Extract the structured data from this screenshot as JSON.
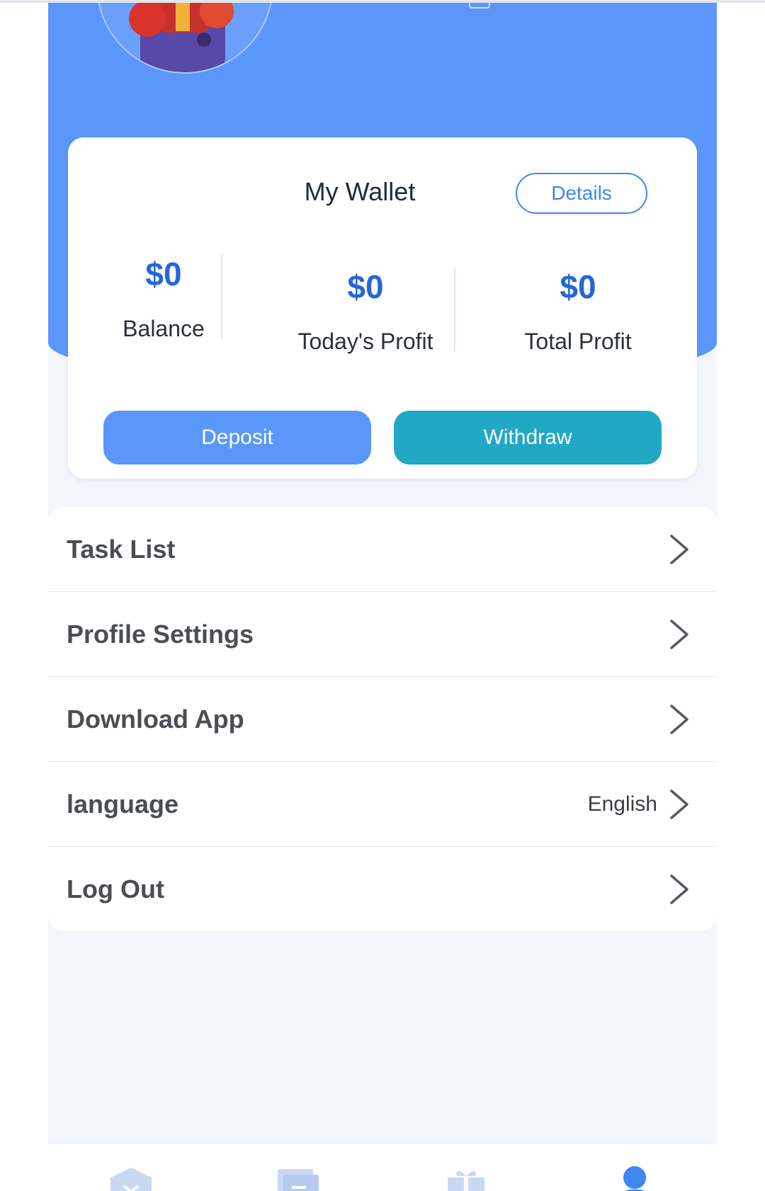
{
  "wallet": {
    "title": "My Wallet",
    "details_label": "Details",
    "balance_value": "$0",
    "balance_label": "Balance",
    "today_profit_value": "$0",
    "today_profit_label": "Today's Profit",
    "total_profit_value": "$0",
    "total_profit_label": "Total Profit",
    "deposit_label": "Deposit",
    "withdraw_label": "Withdraw"
  },
  "menu": {
    "items": [
      {
        "label": "Task List",
        "value": ""
      },
      {
        "label": "Profile Settings",
        "value": ""
      },
      {
        "label": "Download App",
        "value": ""
      },
      {
        "label": "language",
        "value": "English"
      },
      {
        "label": "Log Out",
        "value": ""
      }
    ]
  },
  "tabbar": {
    "icons": [
      "home-icon",
      "orders-icon",
      "gift-icon",
      "user-icon"
    ],
    "active_index": 3
  },
  "colors": {
    "primary": "#5b96fb",
    "accent_value": "#2566d9",
    "withdraw": "#21a8c4",
    "page_bg": "#f3f6fc"
  }
}
